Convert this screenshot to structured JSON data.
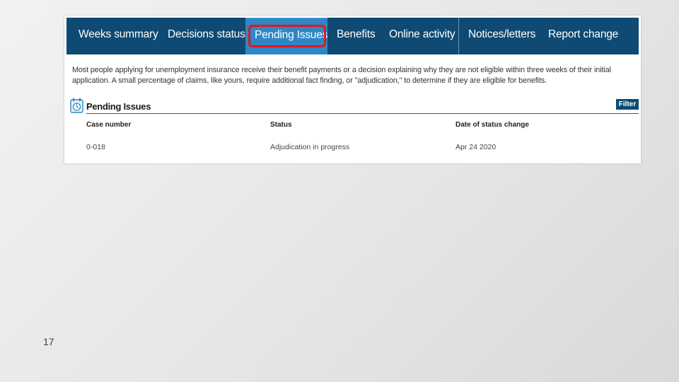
{
  "nav": {
    "tabs": [
      {
        "label": "Weeks summary"
      },
      {
        "label": "Decisions status"
      },
      {
        "label": "Pending Issues"
      },
      {
        "label": "Benefits"
      },
      {
        "label": "Online activity"
      },
      {
        "label": "Notices/letters"
      },
      {
        "label": "Report change"
      }
    ],
    "active_tab": "Pending Issues"
  },
  "intro": {
    "text": "Most people applying for unemployment insurance receive their benefit payments or a decision explaining why they are not eligible within three weeks of their initial application. A small percentage of claims, like yours, require additional fact finding, or \"adjudication,\" to determine if they are eligible for benefits."
  },
  "section": {
    "title": "Pending Issues",
    "icon": "calendar-clock-icon",
    "filter_label": "Filter"
  },
  "table": {
    "headers": [
      "Case number",
      "Status",
      "Date of status change"
    ],
    "rows": [
      [
        "0-018",
        "Adjudication in progress",
        "Apr 24 2020"
      ]
    ]
  },
  "slide": {
    "page_number": "17"
  },
  "colors": {
    "nav_bg": "#0e4a73",
    "active_tab_bg": "#2e87c4",
    "highlight": "#e2161d"
  }
}
